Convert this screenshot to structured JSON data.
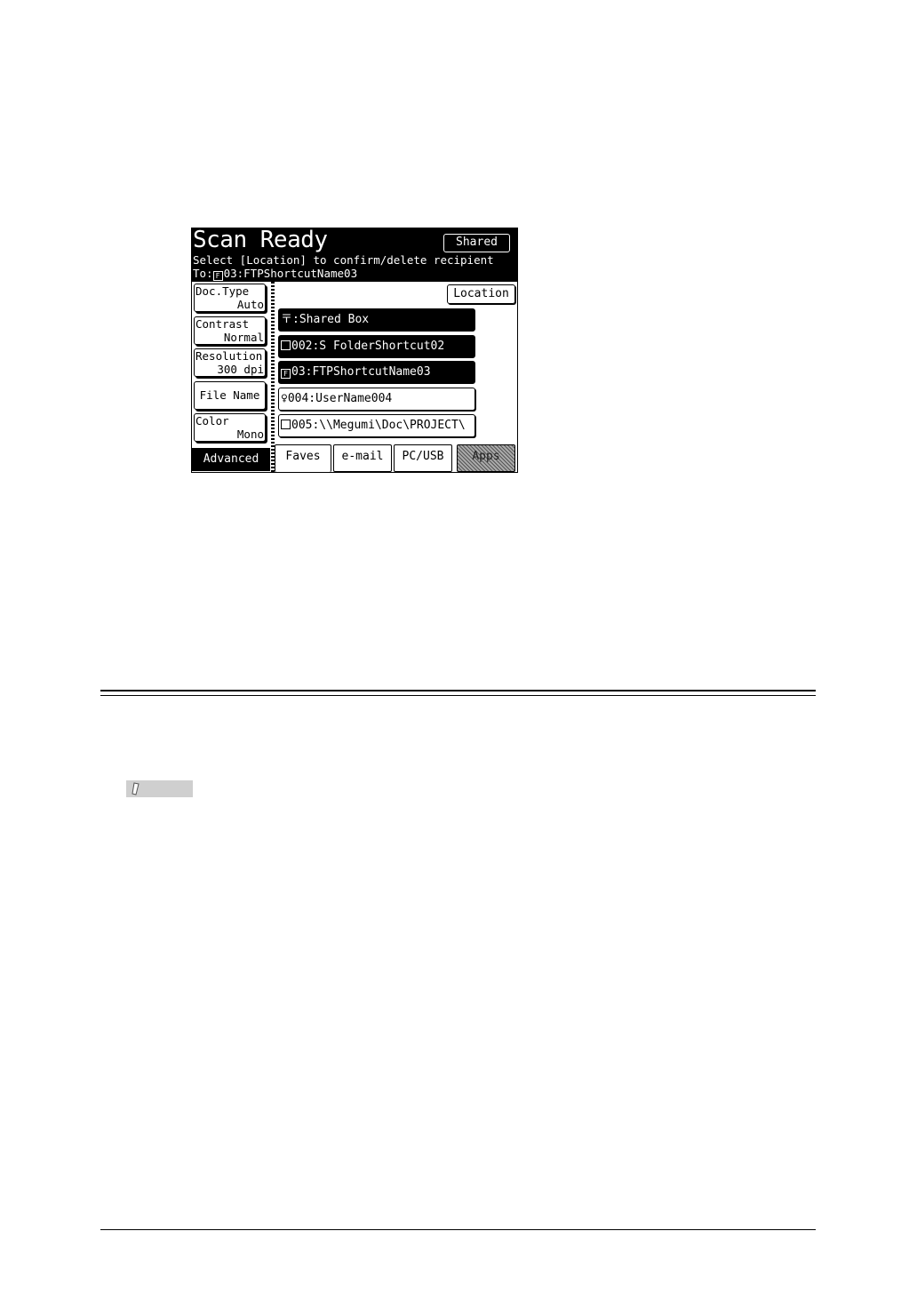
{
  "screen": {
    "title": "Scan Ready",
    "shared_button": "Shared",
    "message": "Select [Location] to confirm/delete recipient",
    "to_label": "To:",
    "to_value": "03:FTPShortcutName03",
    "location_button": "Location",
    "settings": [
      {
        "label": "Doc.Type",
        "value": "Auto"
      },
      {
        "label": "Contrast",
        "value": "Normal"
      },
      {
        "label": "Resolution",
        "value": "300 dpi"
      },
      {
        "label": "File Name",
        "value": ""
      },
      {
        "label": "Color",
        "value": "Mono"
      }
    ],
    "advanced_button": "Advanced",
    "recipients": [
      {
        "icon": "shared-box-icon",
        "glyph": "〒",
        "text": ":Shared Box",
        "selected": true
      },
      {
        "icon": "folder-icon",
        "glyph": "▭",
        "text": "002:S FolderShortcut02",
        "selected": true
      },
      {
        "icon": "ftp-icon",
        "glyph": "▣",
        "text": "03:FTPShortcutName03",
        "selected": true
      },
      {
        "icon": "user-icon",
        "glyph": "♀",
        "text": "004:UserName004",
        "selected": false
      },
      {
        "icon": "folder-icon",
        "glyph": "▭",
        "text": "005:\\\\Megumi\\Doc\\PROJECT\\",
        "selected": false
      }
    ],
    "tabs": [
      "Faves",
      "e-mail",
      "PC/USB",
      "Apps"
    ]
  }
}
